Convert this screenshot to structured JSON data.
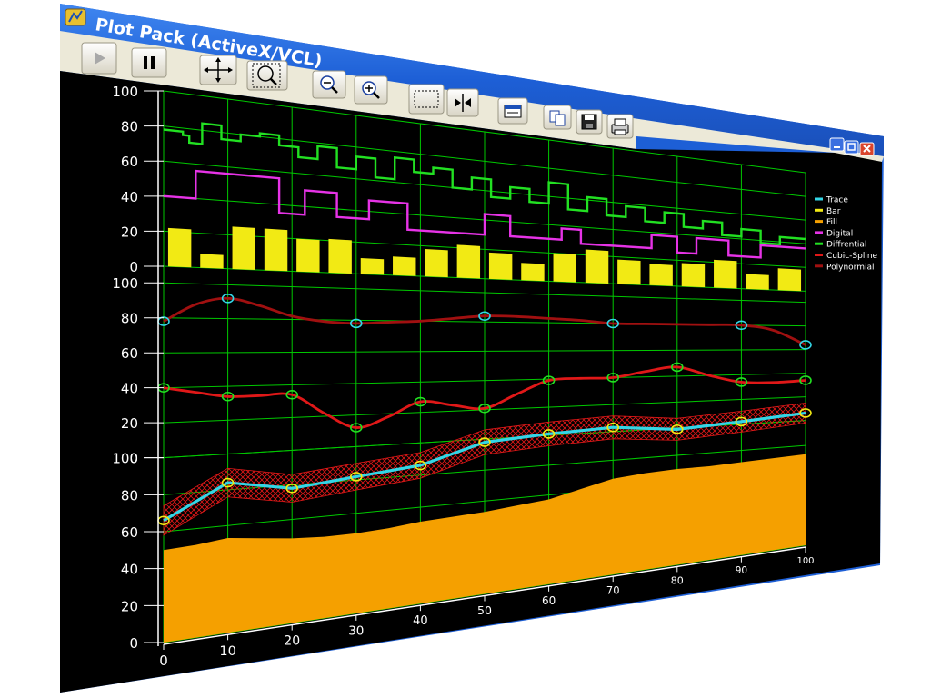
{
  "window": {
    "title": "Plot Pack (ActiveX/VCL)",
    "colors": {
      "titlebar": "#1d5fd6",
      "toolbar": "#ece9d8",
      "plot_bg": "#000000",
      "grid": "#00c800",
      "axis_text": "#ffffff",
      "window_buttons": "#3a6fe0",
      "close_button": "#d9442c"
    },
    "controls": [
      "minimize-icon",
      "maximize-icon",
      "close-icon"
    ]
  },
  "toolbar": {
    "buttons": [
      {
        "name": "play-button",
        "icon": "play-icon"
      },
      {
        "name": "pause-button",
        "icon": "pause-icon"
      },
      {
        "name": "pan-button",
        "icon": "move-icon"
      },
      {
        "name": "zoom-box-button",
        "icon": "zoom-box-icon"
      },
      {
        "name": "zoom-out-button",
        "icon": "zoom-out-icon"
      },
      {
        "name": "zoom-in-button",
        "icon": "zoom-in-icon"
      },
      {
        "name": "select-rect-button",
        "icon": "select-rect-icon"
      },
      {
        "name": "cursor-button",
        "icon": "cursor-split-icon"
      },
      {
        "name": "properties-button",
        "icon": "properties-icon"
      },
      {
        "name": "copy-button",
        "icon": "copy-icon"
      },
      {
        "name": "save-button",
        "icon": "save-icon"
      },
      {
        "name": "print-button",
        "icon": "print-icon"
      }
    ]
  },
  "legend": [
    {
      "label": "Trace",
      "color": "#33d6e6"
    },
    {
      "label": "Bar",
      "color": "#f2ea14"
    },
    {
      "label": "Fill",
      "color": "#f5a000"
    },
    {
      "label": "Digital",
      "color": "#e633e6"
    },
    {
      "label": "Diffrential",
      "color": "#22e022"
    },
    {
      "label": "Cubic-Spline",
      "color": "#e01818"
    },
    {
      "label": "Polynormial",
      "color": "#a01010"
    }
  ],
  "chart_data": {
    "type": "line",
    "x_ticks": [
      0,
      10,
      20,
      30,
      40,
      50,
      60,
      70,
      80,
      90,
      100
    ],
    "xlim": [
      0,
      100
    ],
    "grid": true,
    "legend_placement": "right",
    "panels": [
      {
        "name": "top",
        "ylim": [
          0,
          100
        ],
        "y_ticks": [
          0,
          20,
          40,
          60,
          80,
          100
        ],
        "series": [
          {
            "name": "Diffrential",
            "kind": "step",
            "color": "#22e022",
            "x": [
              0,
              3,
              4,
              6,
              9,
              12,
              15,
              18,
              21,
              24,
              27,
              30,
              33,
              36,
              39,
              42,
              45,
              48,
              51,
              54,
              57,
              60,
              63,
              66,
              69,
              72,
              75,
              78,
              81,
              84,
              87,
              90,
              93,
              96,
              100
            ],
            "y": [
              78,
              76,
              72,
              84,
              76,
              80,
              82,
              76,
              70,
              78,
              66,
              74,
              62,
              76,
              68,
              72,
              60,
              68,
              56,
              64,
              55,
              70,
              52,
              62,
              50,
              58,
              48,
              56,
              46,
              52,
              42,
              48,
              38,
              44,
              44
            ]
          },
          {
            "name": "Digital",
            "kind": "step",
            "color": "#e633e6",
            "x": [
              0,
              5,
              15,
              18,
              22,
              27,
              32,
              38,
              50,
              54,
              62,
              65,
              76,
              80,
              83,
              88,
              93,
              100
            ],
            "y": [
              40,
              56,
              56,
              35,
              50,
              35,
              47,
              30,
              44,
              30,
              38,
              28,
              38,
              26,
              38,
              26,
              36,
              36
            ]
          },
          {
            "name": "Bar",
            "kind": "bar",
            "color": "#f2ea14",
            "x": [
              2.5,
              7.5,
              12.5,
              17.5,
              22.5,
              27.5,
              32.5,
              37.5,
              42.5,
              47.5,
              52.5,
              57.5,
              62.5,
              67.5,
              72.5,
              77.5,
              82.5,
              87.5,
              92.5,
              97.5
            ],
            "y": [
              22,
              8,
              25,
              25,
              20,
              21,
              10,
              12,
              18,
              22,
              18,
              12,
              20,
              24,
              18,
              16,
              18,
              22,
              12,
              18
            ]
          }
        ]
      },
      {
        "name": "middle",
        "ylim": [
          0,
          100
        ],
        "y_ticks": [
          0,
          20,
          40,
          60,
          80,
          100
        ],
        "series": [
          {
            "name": "Polynormial",
            "kind": "curve",
            "color": "#a01010",
            "x": [
              0,
              5,
              10,
              15,
              20,
              25,
              30,
              35,
              40,
              45,
              50,
              55,
              60,
              65,
              70,
              75,
              80,
              85,
              90,
              95,
              100
            ],
            "y": [
              78,
              88,
              92,
              88,
              82,
              79,
              78,
              79,
              80,
              82,
              84,
              84,
              83,
              82,
              80,
              80,
              80,
              80,
              80,
              76,
              64
            ],
            "markers": {
              "color": "#33d6e6",
              "x": [
                0,
                10,
                30,
                50,
                70,
                90,
                100
              ],
              "y": [
                78,
                92,
                78,
                84,
                80,
                80,
                64
              ]
            }
          },
          {
            "name": "Cubic-Spline",
            "kind": "curve",
            "color": "#e01818",
            "x": [
              0,
              5,
              10,
              15,
              20,
              25,
              30,
              35,
              40,
              45,
              50,
              55,
              60,
              65,
              70,
              75,
              80,
              85,
              90,
              95,
              100
            ],
            "y": [
              40,
              37,
              34,
              34,
              34,
              22,
              12,
              18,
              27,
              24,
              21,
              30,
              39,
              40,
              40,
              44,
              47,
              40,
              34,
              33,
              34
            ],
            "markers": {
              "color": "#22e022",
              "x": [
                0,
                10,
                20,
                30,
                40,
                50,
                60,
                70,
                80,
                90,
                100
              ],
              "y": [
                40,
                34,
                34,
                12,
                27,
                21,
                39,
                40,
                47,
                34,
                34
              ]
            }
          }
        ]
      },
      {
        "name": "bottom",
        "ylim": [
          0,
          100
        ],
        "y_ticks": [
          0,
          20,
          40,
          60,
          80,
          100
        ],
        "series": [
          {
            "name": "Fill",
            "kind": "area",
            "color": "#f5a000",
            "x": [
              0,
              5,
              10,
              15,
              20,
              25,
              30,
              35,
              40,
              45,
              50,
              55,
              60,
              65,
              70,
              75,
              80,
              85,
              90,
              95,
              100
            ],
            "y": [
              50,
              51,
              53,
              51,
              49,
              48,
              48,
              49,
              51,
              52,
              53,
              55,
              57,
              62,
              67,
              69,
              70,
              70,
              71,
              72,
              73
            ]
          },
          {
            "name": "Trace",
            "kind": "line",
            "color": "#33d6e6",
            "x": [
              0,
              10,
              20,
              30,
              40,
              50,
              60,
              70,
              80,
              90,
              100
            ],
            "y": [
              66,
              84,
              78,
              82,
              86,
              98,
              101,
              103,
              99,
              102,
              106
            ],
            "band": {
              "color": "#e01818",
              "width": 8
            },
            "markers": {
              "color": "#f2ea14"
            }
          }
        ]
      }
    ]
  }
}
